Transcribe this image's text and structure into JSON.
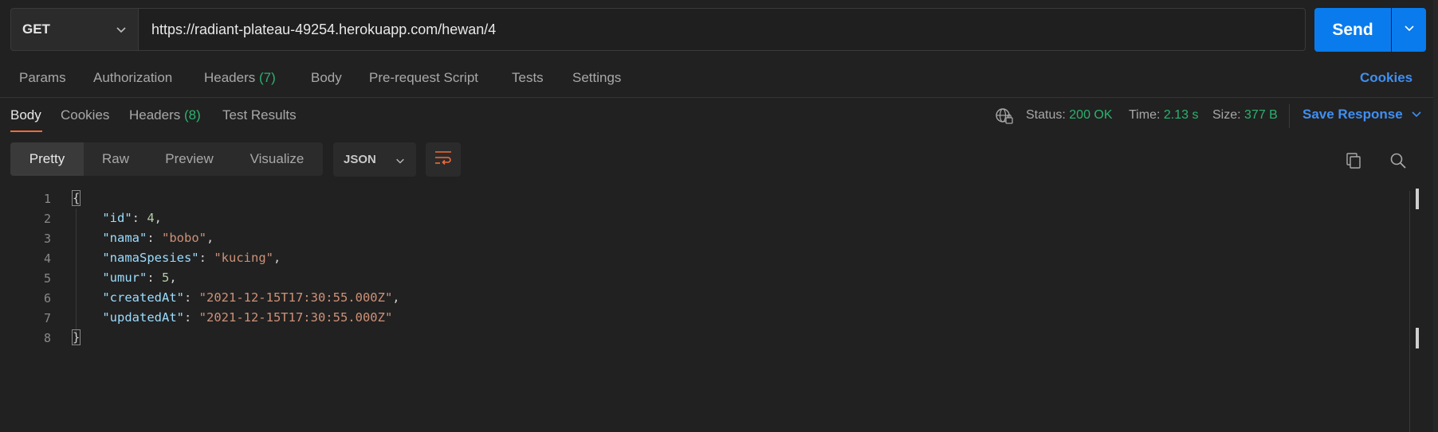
{
  "request": {
    "method": "GET",
    "url": "https://radiant-plateau-49254.herokuapp.com/hewan/4",
    "send_label": "Send"
  },
  "request_tabs": {
    "params": "Params",
    "authorization": "Authorization",
    "headers": "Headers",
    "headers_count": "(7)",
    "body": "Body",
    "pre_request": "Pre-request Script",
    "tests": "Tests",
    "settings": "Settings",
    "cookies": "Cookies"
  },
  "response_tabs": {
    "body": "Body",
    "cookies": "Cookies",
    "headers": "Headers",
    "headers_count": "(8)",
    "test_results": "Test Results"
  },
  "response_meta": {
    "status_label": "Status:",
    "status_value": "200 OK",
    "time_label": "Time:",
    "time_value": "2.13 s",
    "size_label": "Size:",
    "size_value": "377 B",
    "save_response": "Save Response"
  },
  "view_modes": {
    "pretty": "Pretty",
    "raw": "Raw",
    "preview": "Preview",
    "visualize": "Visualize",
    "format": "JSON"
  },
  "response_body": {
    "lines": [
      {
        "num": "1",
        "open": "{"
      },
      {
        "num": "2",
        "key": "\"id\"",
        "val": "4",
        "type": "n",
        "tail": ","
      },
      {
        "num": "3",
        "key": "\"nama\"",
        "val": "\"bobo\"",
        "type": "s",
        "tail": ","
      },
      {
        "num": "4",
        "key": "\"namaSpesies\"",
        "val": "\"kucing\"",
        "type": "s",
        "tail": ","
      },
      {
        "num": "5",
        "key": "\"umur\"",
        "val": "5",
        "type": "n",
        "tail": ","
      },
      {
        "num": "6",
        "key": "\"createdAt\"",
        "val": "\"2021-12-15T17:30:55.000Z\"",
        "type": "s",
        "tail": ","
      },
      {
        "num": "7",
        "key": "\"updatedAt\"",
        "val": "\"2021-12-15T17:30:55.000Z\"",
        "type": "s",
        "tail": ""
      },
      {
        "num": "8",
        "close": "}"
      }
    ]
  },
  "colors": {
    "accent": "#097bed",
    "link": "#3f8ff2",
    "success": "#2cb26f",
    "active_tab": "#f26b3a"
  }
}
